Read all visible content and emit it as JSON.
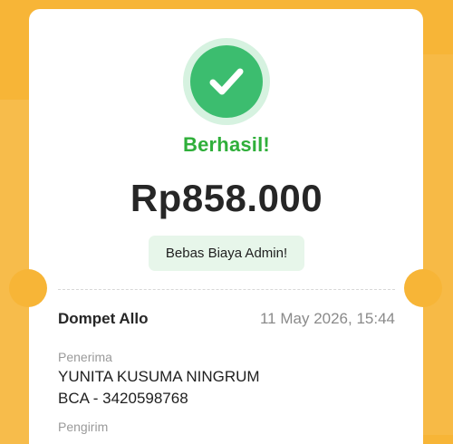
{
  "status": {
    "title": "Berhasil!",
    "icon": "check-icon"
  },
  "amount": "Rp858.000",
  "fee_badge": "Bebas Biaya Admin!",
  "transaction": {
    "source": "Dompet Allo",
    "datetime": "11 May 2026, 15:44"
  },
  "recipient": {
    "label": "Penerima",
    "name": "YUNITA KUSUMA NINGRUM",
    "account": "BCA - 3420598768"
  },
  "sender": {
    "label": "Pengirim"
  },
  "colors": {
    "background": "#F7B537",
    "success_green": "#3CBD6F",
    "status_text": "#2FAF3A",
    "fee_badge_bg": "#E7F6EA"
  }
}
